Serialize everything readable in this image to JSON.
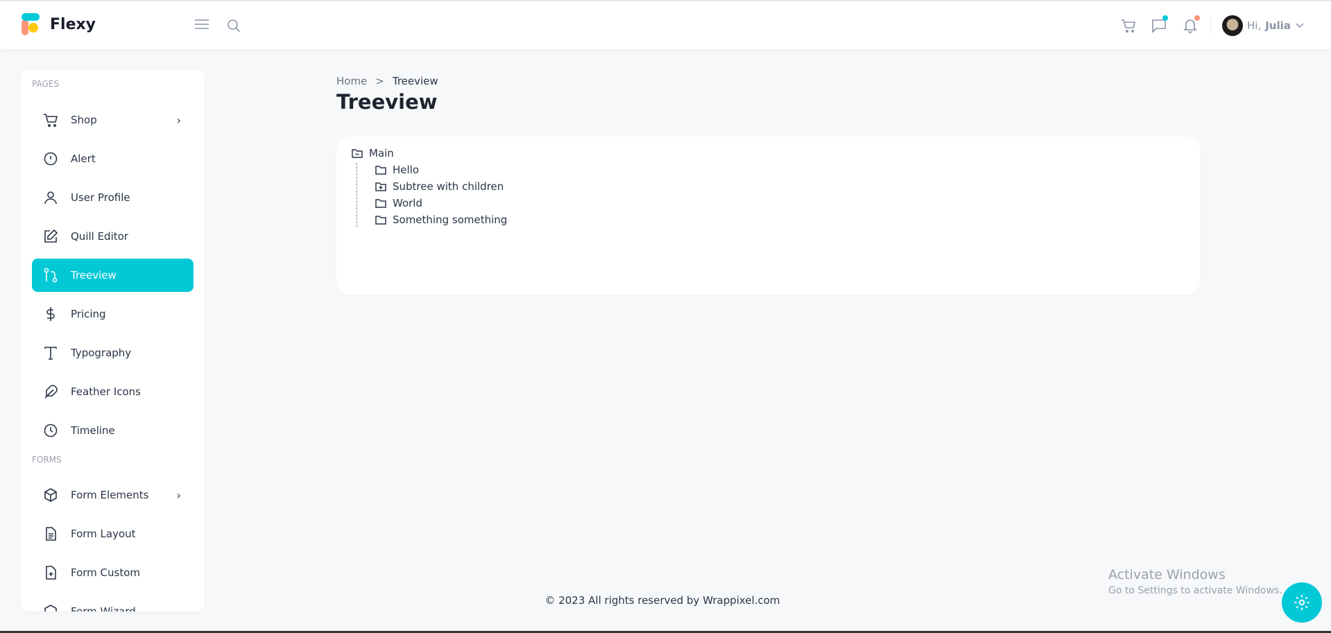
{
  "header": {
    "brand": "Flexy",
    "greeting": "Hi,",
    "user_name": "Julia",
    "colors": {
      "accent": "#03c9d7",
      "notify": "#fb9678"
    }
  },
  "sidebar": {
    "sections": [
      {
        "label": "PAGES",
        "items": [
          {
            "label": "Shop",
            "icon": "cart-icon",
            "has_children": true
          },
          {
            "label": "Alert",
            "icon": "alert-circle-icon"
          },
          {
            "label": "User Profile",
            "icon": "user-icon"
          },
          {
            "label": "Quill Editor",
            "icon": "edit-icon"
          },
          {
            "label": "Treeview",
            "icon": "git-pull-request-icon",
            "active": true
          },
          {
            "label": "Pricing",
            "icon": "dollar-icon"
          },
          {
            "label": "Typography",
            "icon": "type-icon"
          },
          {
            "label": "Feather Icons",
            "icon": "feather-icon"
          },
          {
            "label": "Timeline",
            "icon": "clock-icon"
          }
        ]
      },
      {
        "label": "FORMS",
        "items": [
          {
            "label": "Form Elements",
            "icon": "box-icon",
            "has_children": true
          },
          {
            "label": "Form Layout",
            "icon": "file-text-icon"
          },
          {
            "label": "Form Custom",
            "icon": "file-plus-icon"
          },
          {
            "label": "Form Wizard",
            "icon": "codesandbox-icon"
          }
        ]
      }
    ]
  },
  "breadcrumb": {
    "home": "Home",
    "separator": ">",
    "current": "Treeview"
  },
  "page_title": "Treeview",
  "tree": {
    "root": "Main",
    "children": [
      "Hello",
      "Subtree with children",
      "World",
      "Something something"
    ]
  },
  "footer": "© 2023 All rights reserved by Wrappixel.com",
  "watermark": {
    "line1": "Activate Windows",
    "line2": "Go to Settings to activate Windows."
  }
}
